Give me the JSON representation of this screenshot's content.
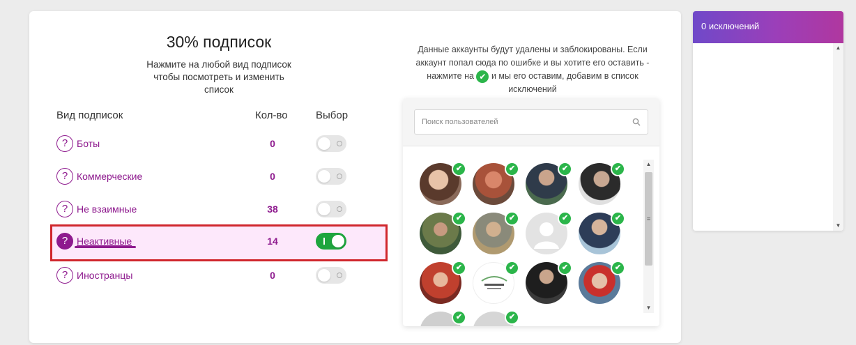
{
  "summary": {
    "title": "30% подписок",
    "subtitle": "Нажмите на любой вид подписок чтобы посмотреть и изменить список"
  },
  "table": {
    "headers": {
      "type": "Вид подписок",
      "count": "Кол-во",
      "choice": "Выбор"
    },
    "rows": [
      {
        "label": "Боты",
        "count": "0",
        "selected": false
      },
      {
        "label": "Коммерческие",
        "count": "0",
        "selected": false
      },
      {
        "label": "Не взаимные",
        "count": "38",
        "selected": false
      },
      {
        "label": "Неактивные",
        "count": "14",
        "selected": true
      },
      {
        "label": "Иностранцы",
        "count": "0",
        "selected": false
      }
    ]
  },
  "info": {
    "text_before": "Данные аккаунты будут удалены и заблокированы. Если аккаунт попал сюда по ошибке и вы хотите его оставить - нажмите на",
    "text_after": "и мы его оставим, добавим в список исключений"
  },
  "search": {
    "placeholder": "Поиск пользователей",
    "value": ""
  },
  "exclusions": {
    "title": "0 исключений"
  },
  "colors": {
    "accent": "#8e1a8e",
    "toggle_on": "#1ea53e",
    "check": "#2bb54a",
    "highlight_bg": "#fde8fb",
    "highlight_border": "#d0262c",
    "header_gradient_start": "#6f49c9",
    "header_gradient_end": "#b0379f"
  },
  "icons": {
    "question": "question-circle-icon",
    "check": "check-circle-icon",
    "search": "search-icon"
  },
  "avatars": [
    {
      "kind": "photo",
      "checked": true
    },
    {
      "kind": "photo",
      "checked": true
    },
    {
      "kind": "photo",
      "checked": true
    },
    {
      "kind": "photo",
      "checked": true
    },
    {
      "kind": "photo",
      "checked": true
    },
    {
      "kind": "photo",
      "checked": true
    },
    {
      "kind": "placeholder",
      "checked": true
    },
    {
      "kind": "photo",
      "checked": true
    },
    {
      "kind": "photo",
      "checked": true
    },
    {
      "kind": "logo",
      "checked": true
    },
    {
      "kind": "photo",
      "checked": true
    },
    {
      "kind": "photo",
      "checked": true
    }
  ]
}
